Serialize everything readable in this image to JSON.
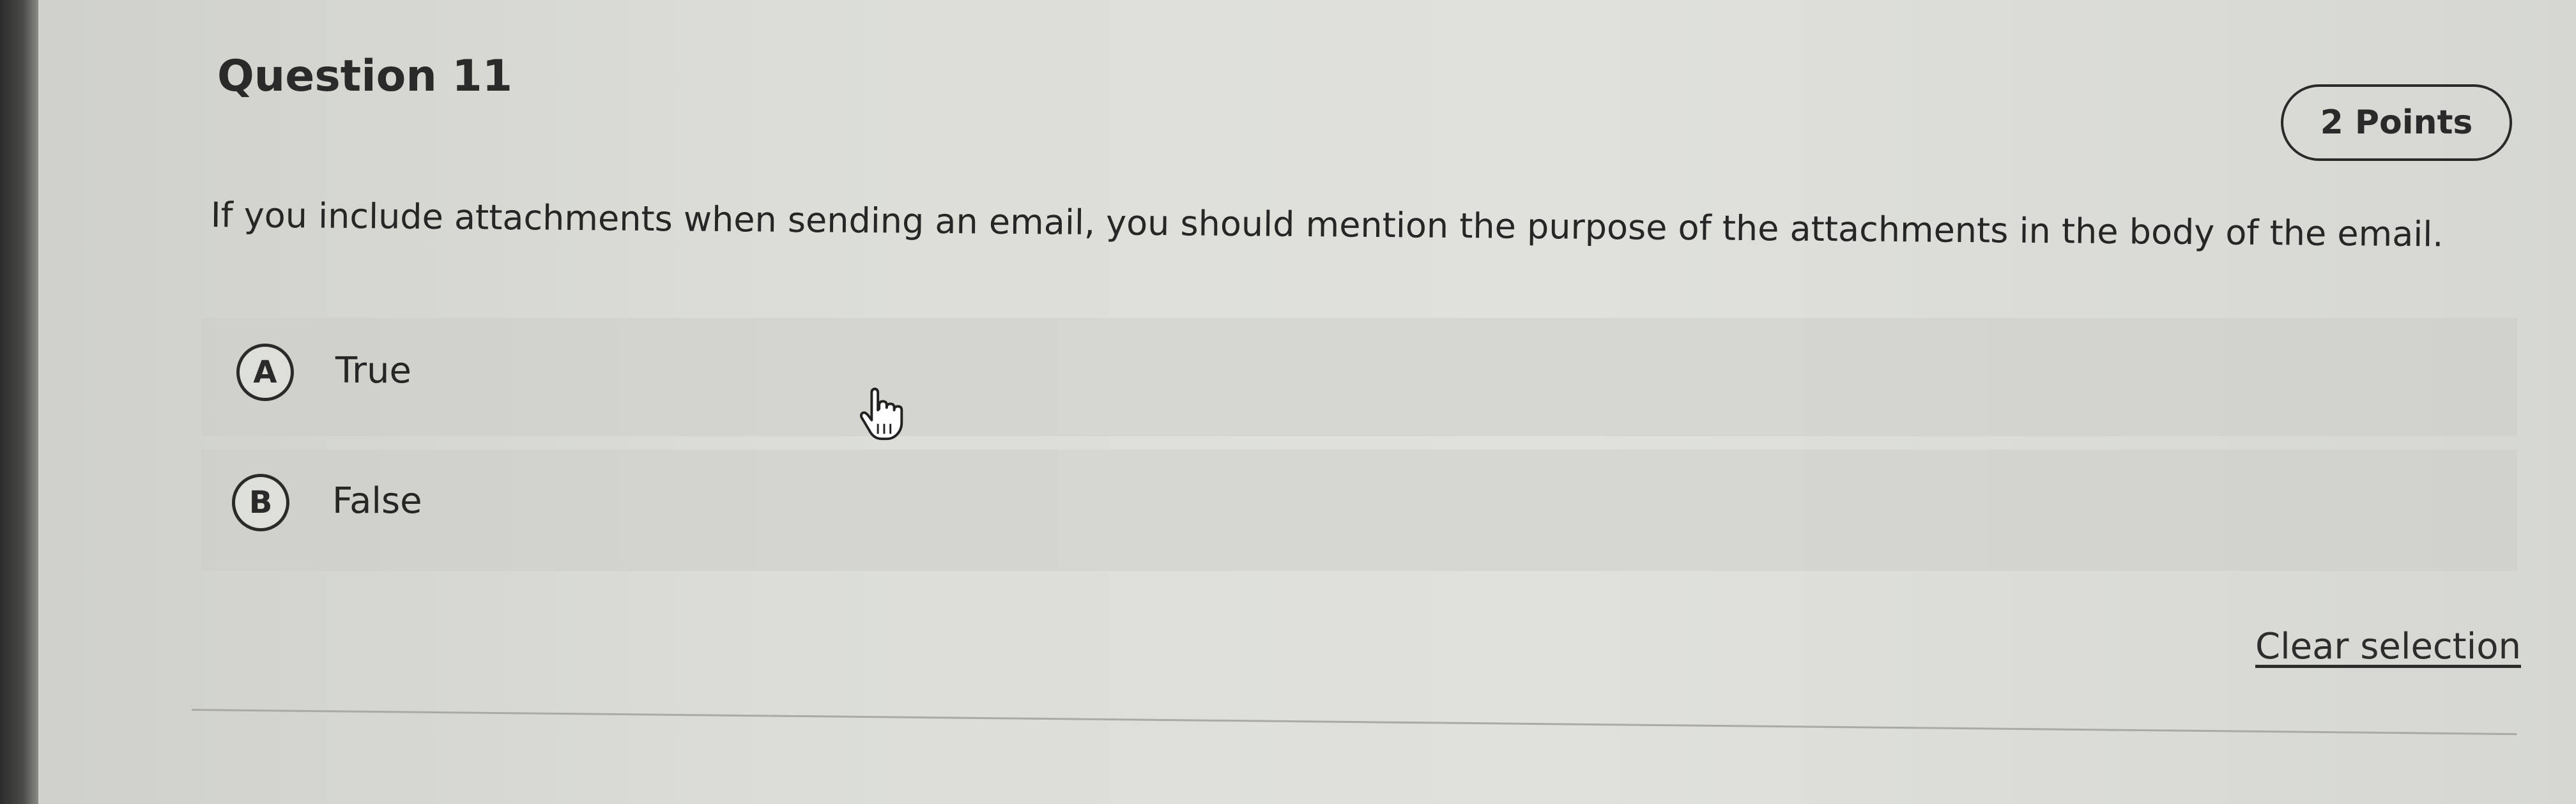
{
  "question": {
    "title": "Question 11",
    "points": "2 Points",
    "text": "If you include attachments when sending an email, you should mention the purpose of the attachments in the body of the email."
  },
  "options": [
    {
      "letter": "A",
      "label": "True"
    },
    {
      "letter": "B",
      "label": "False"
    }
  ],
  "actions": {
    "clear_selection": "Clear selection"
  },
  "icons": {
    "cursor": "hand-pointer-icon"
  }
}
